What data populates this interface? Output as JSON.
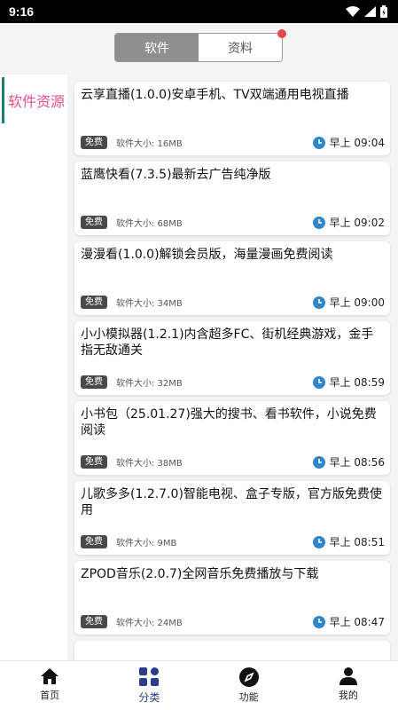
{
  "status_bar": {
    "time": "9:16",
    "icons": [
      "wifi-icon",
      "cellular-icon",
      "battery-icon"
    ]
  },
  "segments": {
    "items": [
      "软件",
      "资料"
    ],
    "active_index": 0,
    "badge_color": "#e8474a"
  },
  "sidebar": {
    "items": [
      {
        "label": "软件资源",
        "active": true
      }
    ],
    "accent_color": "#1e7b76",
    "label_color": "#e2518e"
  },
  "cards": [
    {
      "title": "云享直播(1.0.0)安卓手机、TV双端通用电视直播",
      "tag": "免费",
      "size": "软件大小: 16MB",
      "time": "早上 09:04"
    },
    {
      "title": "蓝鹰快看(7.3.5)最新去广告纯净版",
      "tag": "免费",
      "size": "软件大小: 68MB",
      "time": "早上 09:02"
    },
    {
      "title": "漫漫看(1.0.0)解锁会员版，海量漫画免费阅读",
      "tag": "免费",
      "size": "软件大小: 34MB",
      "time": "早上 09:00"
    },
    {
      "title": "小小模拟器(1.2.1)内含超多FC、街机经典游戏，金手指无敌通关",
      "tag": "免费",
      "size": "软件大小: 32MB",
      "time": "早上 08:59"
    },
    {
      "title": "小书包（25.01.27)强大的搜书、看书软件，小说免费阅读",
      "tag": "免费",
      "size": "软件大小: 38MB",
      "time": "早上 08:56"
    },
    {
      "title": "儿歌多多(1.2.7.0)智能电视、盒子专版，官方版免费使用",
      "tag": "免费",
      "size": "软件大小: 9MB",
      "time": "早上 08:51"
    },
    {
      "title": "ZPOD音乐(2.0.7)全网音乐免费播放与下载",
      "tag": "免费",
      "size": "软件大小: 24MB",
      "time": "早上 08:47"
    }
  ],
  "tabbar": {
    "items": [
      {
        "label": "首页",
        "icon": "home-icon"
      },
      {
        "label": "分类",
        "icon": "category-grid-icon",
        "active": true
      },
      {
        "label": "功能",
        "icon": "compass-icon"
      },
      {
        "label": "我的",
        "icon": "person-icon"
      }
    ],
    "active_color": "#2c3b8f"
  },
  "clock_color": "#2f86c9"
}
